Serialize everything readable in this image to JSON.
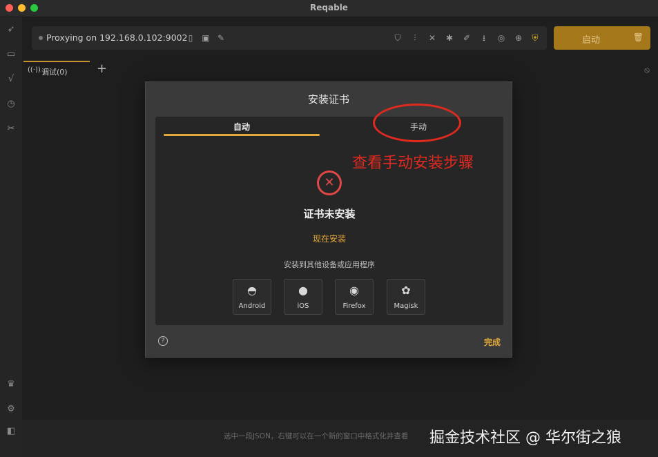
{
  "window": {
    "title": "Reqable"
  },
  "toolbar": {
    "proxy_status": "Proxying on 192.168.0.102:9002",
    "start_label": "启动",
    "icons": [
      "phone-icon",
      "image-icon",
      "pencil-icon",
      "shield-icon",
      "filter-icon",
      "wand-off-icon",
      "bug-icon",
      "script-icon",
      "download-icon",
      "target-icon",
      "globe-icon",
      "security-icon"
    ]
  },
  "tabs": [
    {
      "label": "调试(0)"
    }
  ],
  "dialog": {
    "title": "安装证书",
    "tab_auto": "自动",
    "tab_manual": "手动",
    "status": "证书未安装",
    "install_now": "现在安装",
    "other_label": "安装到其他设备或应用程序",
    "platforms": [
      {
        "label": "Android",
        "icon": "android-icon"
      },
      {
        "label": "iOS",
        "icon": "apple-icon"
      },
      {
        "label": "Firefox",
        "icon": "firefox-icon"
      },
      {
        "label": "Magisk",
        "icon": "magisk-icon"
      }
    ],
    "done_label": "完成"
  },
  "annotation": {
    "text": "查看手动安装步骤",
    "color": "#e02a1f"
  },
  "statusbar": {
    "hint": "选中一段JSON，右键可以在一个新的窗口中格式化并查看",
    "watermark": "掘金技术社区 @ 华尔街之狼"
  },
  "colors": {
    "accent": "#c8962e",
    "error": "#e04848",
    "link": "#e3a83a"
  }
}
